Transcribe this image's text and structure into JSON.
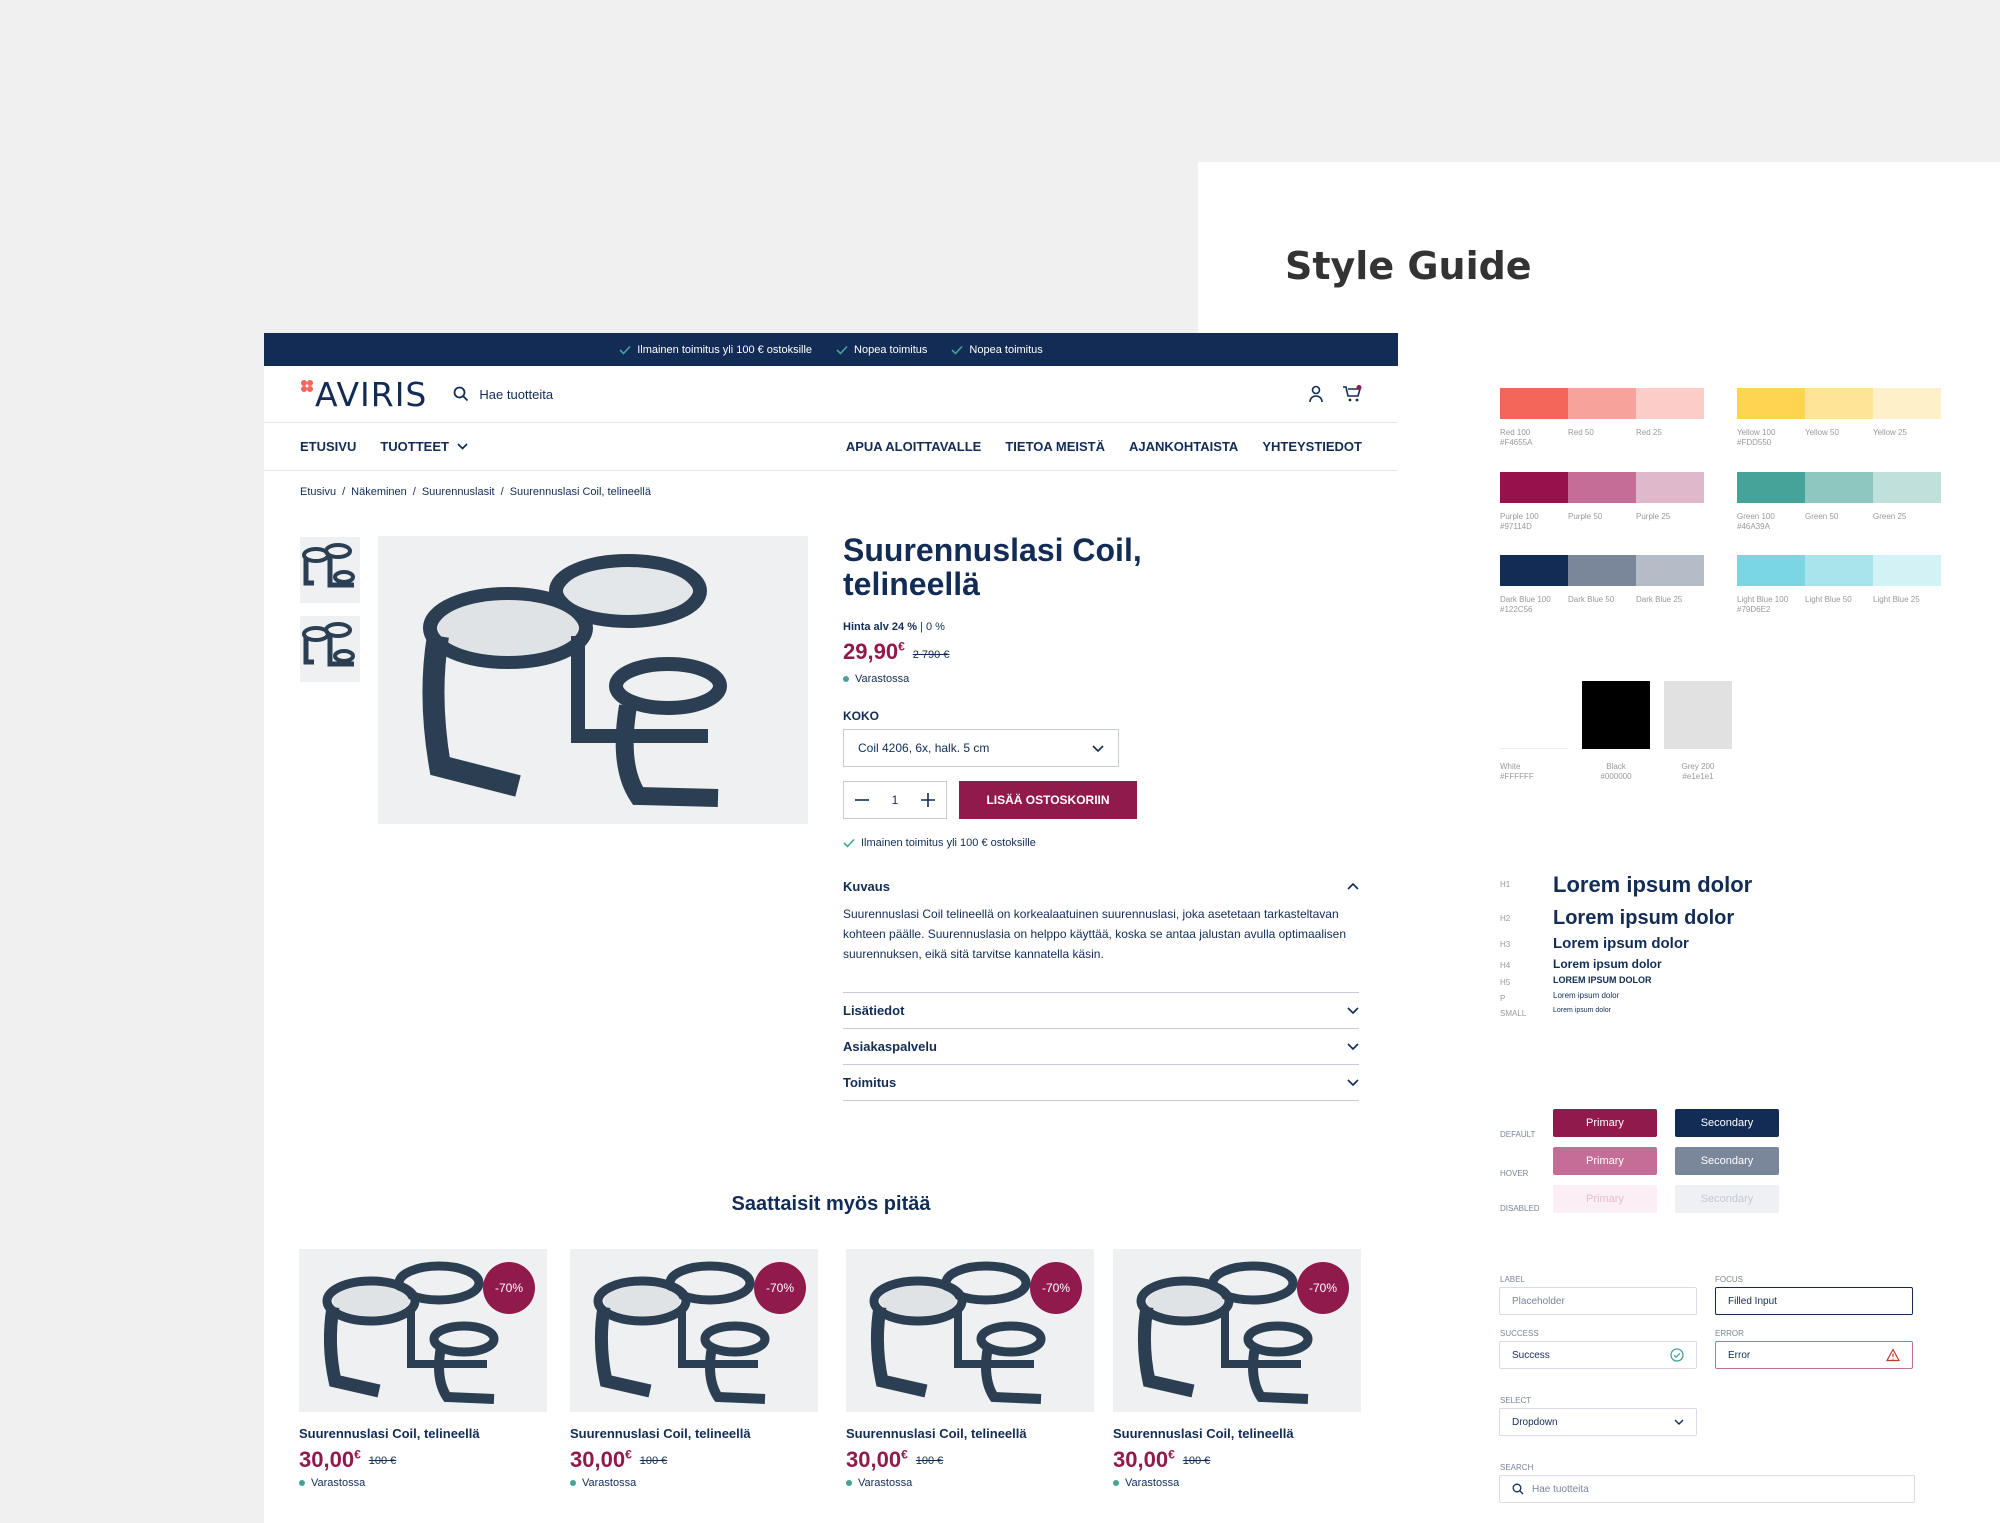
{
  "style_guide": {
    "title": "Style Guide",
    "colors": {
      "row1_left": [
        {
          "hex": "#F4655A",
          "name": "Red 100",
          "code": "#F4655A"
        },
        {
          "hex": "#F8A29C",
          "name": "Red 50",
          "code": ""
        },
        {
          "hex": "#FCCCC9",
          "name": "Red 25",
          "code": ""
        }
      ],
      "row1_right": [
        {
          "hex": "#FDD550",
          "name": "Yellow 100",
          "code": "#FDD550"
        },
        {
          "hex": "#FEE497",
          "name": "Yellow 50",
          "code": ""
        },
        {
          "hex": "#FEF0C8",
          "name": "Yellow 25",
          "code": ""
        }
      ],
      "row2_left": [
        {
          "hex": "#97114D",
          "name": "Purple 100",
          "code": "#97114D"
        },
        {
          "hex": "#C46D96",
          "name": "Purple 50",
          "code": ""
        },
        {
          "hex": "#E0B8CB",
          "name": "Purple 25",
          "code": ""
        }
      ],
      "row2_right": [
        {
          "hex": "#46A39A",
          "name": "Green 100",
          "code": "#46A39A"
        },
        {
          "hex": "#8EC7C0",
          "name": "Green 50",
          "code": ""
        },
        {
          "hex": "#BFE0DB",
          "name": "Green 25",
          "code": ""
        }
      ],
      "row3_left": [
        {
          "hex": "#122C56",
          "name": "Dark Blue 100",
          "code": "#122C56"
        },
        {
          "hex": "#7A869A",
          "name": "Dark Blue 50",
          "code": ""
        },
        {
          "hex": "#B4BCC8",
          "name": "Dark Blue 25",
          "code": ""
        }
      ],
      "row3_right": [
        {
          "hex": "#79D6E2",
          "name": "Light Blue 100",
          "code": "#79D6E2"
        },
        {
          "hex": "#A9E4EC",
          "name": "Light Blue 50",
          "code": ""
        },
        {
          "hex": "#D3F2F6",
          "name": "Light Blue 25",
          "code": ""
        }
      ],
      "neutrals": [
        {
          "hex": "#FFFFFF",
          "name": "White",
          "code": "#FFFFFF"
        },
        {
          "hex": "#000000",
          "name": "Black",
          "code": "#000000"
        },
        {
          "hex": "#E1E1E1",
          "name": "Grey 200",
          "code": "#e1e1e1"
        }
      ]
    },
    "typography": [
      {
        "tag": "H1",
        "sample": "Lorem ipsum dolor"
      },
      {
        "tag": "H2",
        "sample": "Lorem ipsum dolor"
      },
      {
        "tag": "H3",
        "sample": "Lorem ipsum dolor"
      },
      {
        "tag": "H4",
        "sample": "Lorem ipsum dolor"
      },
      {
        "tag": "H5",
        "sample": "LOREM IPSUM DOLOR"
      },
      {
        "tag": "P",
        "sample": "Lorem ipsum dolor"
      },
      {
        "tag": "SMALL",
        "sample": "Lorem ipsum dolor"
      }
    ],
    "button_states": {
      "default": "DEFAULT",
      "hover": "HOVER",
      "disabled": "DISABLED"
    },
    "buttons": {
      "primary": "Primary",
      "secondary": "Secondary"
    },
    "inputs": {
      "label_lbl": "LABEL",
      "label_ph": "Placeholder",
      "focus_lbl": "FOCUS",
      "focus_val": "Filled Input",
      "success_lbl": "SUCCESS",
      "success_val": "Success",
      "error_lbl": "ERROR",
      "error_val": "Error",
      "select_lbl": "SELECT",
      "select_val": "Dropdown",
      "search_lbl": "SEARCH",
      "search_ph": "Hae tuotteita"
    }
  },
  "shop": {
    "topbar": [
      "Ilmainen toimitus yli 100 € ostoksille",
      "Nopea toimitus",
      "Nopea toimitus"
    ],
    "logo": "AVIRIS",
    "search_placeholder": "Hae tuotteita",
    "nav_left": [
      "ETUSIVU",
      "TUOTTEET"
    ],
    "nav_right": [
      "APUA ALOITTAVALLE",
      "TIETOA MEISTÄ",
      "AJANKOHTAISTA",
      "YHTEYSTIEDOT"
    ],
    "breadcrumb": [
      "Etusivu",
      "Näkeminen",
      "Suurennuslasit",
      "Suurennuslasi Coil, telineellä"
    ],
    "product": {
      "title": "Suurennuslasi Coil, telineellä",
      "price_label": "Hinta alv 24 %",
      "price_label_alt": "0 %",
      "price": "29,90",
      "currency": "€",
      "old_price": "2 790 €",
      "stock": "Varastossa",
      "size_label": "KOKO",
      "size_value": "Coil 4206, 6x, halk. 5 cm",
      "qty": "1",
      "add_to_cart": "LISÄÄ OSTOSKORIIN",
      "free_shipping": "Ilmainen toimitus yli 100 € ostoksille",
      "accordion": [
        {
          "title": "Kuvaus",
          "body": "Suurennuslasi Coil telineellä on korkealaatuinen suurennuslasi, joka asetetaan tarkasteltavan kohteen päälle. Suurennuslasia on helppo käyttää, koska se antaa jalustan avulla optimaalisen suurennuksen, eikä sitä tarvitse kannatella käsin."
        },
        {
          "title": "Lisätiedot"
        },
        {
          "title": "Asiakaspalvelu"
        },
        {
          "title": "Toimitus"
        }
      ]
    },
    "recommendations_title": "Saattaisit myös pitää",
    "recommendations": [
      {
        "badge": "-70%",
        "name": "Suurennuslasi Coil, telineellä",
        "price": "30,00",
        "currency": "€",
        "old_price": "100 €",
        "stock": "Varastossa"
      },
      {
        "badge": "-70%",
        "name": "Suurennuslasi Coil, telineellä",
        "price": "30,00",
        "currency": "€",
        "old_price": "100 €",
        "stock": "Varastossa"
      },
      {
        "badge": "-70%",
        "name": "Suurennuslasi Coil, telineellä",
        "price": "30,00",
        "currency": "€",
        "old_price": "100 €",
        "stock": "Varastossa"
      },
      {
        "badge": "-70%",
        "name": "Suurennuslasi Coil, telineellä",
        "price": "30,00",
        "currency": "€",
        "old_price": "100 €",
        "stock": "Varastossa"
      }
    ]
  }
}
